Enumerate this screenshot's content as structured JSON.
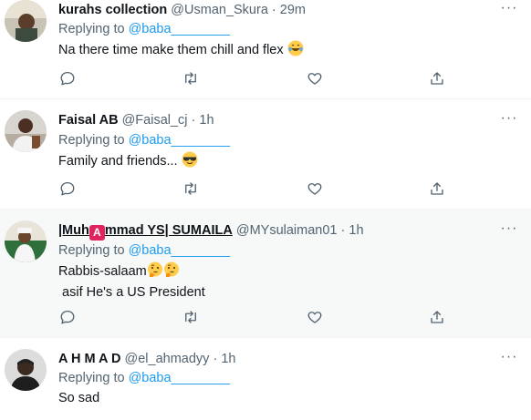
{
  "tweets": [
    {
      "name": "kurahs collection",
      "handle": "@Usman_Skura",
      "dot": "·",
      "time": "29m",
      "replying_label": "Replying to",
      "replying_to": "@baba________",
      "text": "Na there time make them chill and flex",
      "emoji": "laughing-tears-emoji"
    },
    {
      "name": "Faisal AB",
      "handle": "@Faisal_cj",
      "dot": "·",
      "time": "1h",
      "replying_label": "Replying to",
      "replying_to": "@baba________",
      "text": "Family and friends...",
      "emoji": "sunglasses-emoji"
    },
    {
      "name_part1": "|Muh",
      "name_badge": "A",
      "name_part2": "mmad YS| SUMAILA",
      "handle": "@MYsulaiman01",
      "dot": "·",
      "time": "1h",
      "replying_label": "Replying to",
      "replying_to": "@baba________",
      "text_line1": "Rabbis-salaam",
      "text_line2": " asif He's a US President",
      "emoji": "thinking-face-emoji"
    },
    {
      "name": "A H M A D",
      "handle": "@el_ahmadyy",
      "dot": "·",
      "time": "1h",
      "replying_label": "Replying to",
      "replying_to": "@baba________",
      "text": "So sad"
    }
  ],
  "colors": {
    "link": "#1d9bf0",
    "secondary": "#536471",
    "highlight_bg": "#f7f9f9"
  },
  "icons": [
    "reply-icon",
    "retweet-icon",
    "like-icon",
    "share-icon",
    "more-icon"
  ]
}
